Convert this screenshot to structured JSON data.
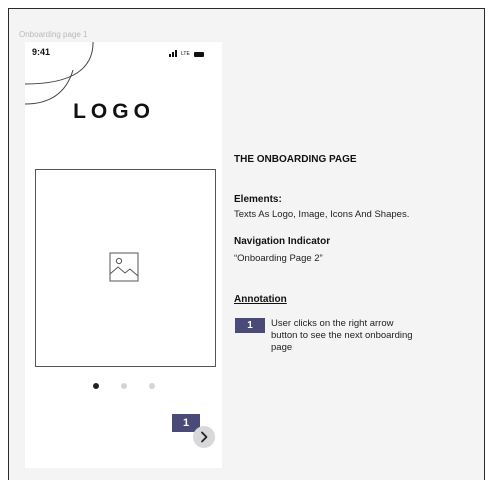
{
  "frame": {
    "label": "Onboarding page 1"
  },
  "phone": {
    "status_time": "9:41",
    "network_label": "LTE",
    "logo_text": "LOGO",
    "pagination": {
      "total": 3,
      "active_index": 0
    },
    "annotation_marker": "1"
  },
  "info": {
    "title": "THE ONBOARDING PAGE",
    "elements_heading": "Elements:",
    "elements_text": "Texts As Logo, Image, Icons And Shapes.",
    "nav_heading": "Navigation Indicator",
    "nav_text": "“Onboarding Page 2”",
    "annotation_heading": "Annotation",
    "annotations": [
      {
        "marker": "1",
        "text": "User clicks on the right arrow button to see the next onboarding page"
      }
    ]
  },
  "colors": {
    "accent": "#4a4a78",
    "canvas": "#f4f4f5",
    "dot_active": "#222222",
    "dot_inactive": "#d4d4d6"
  },
  "icons": [
    "signal-icon",
    "battery-icon",
    "image-placeholder-icon",
    "chevron-right-icon"
  ]
}
